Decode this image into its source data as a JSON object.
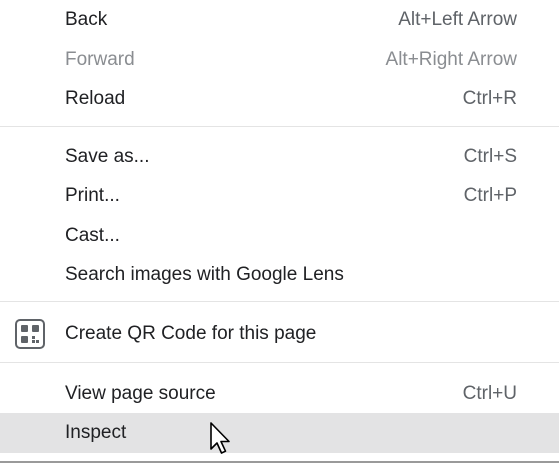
{
  "menu": {
    "items": [
      {
        "label": "Back",
        "shortcut": "Alt+Left Arrow",
        "enabled": true
      },
      {
        "label": "Forward",
        "shortcut": "Alt+Right Arrow",
        "enabled": false
      },
      {
        "label": "Reload",
        "shortcut": "Ctrl+R",
        "enabled": true
      },
      {
        "label": "Save as...",
        "shortcut": "Ctrl+S",
        "enabled": true
      },
      {
        "label": "Print...",
        "shortcut": "Ctrl+P",
        "enabled": true
      },
      {
        "label": "Cast...",
        "shortcut": "",
        "enabled": true
      },
      {
        "label": "Search images with Google Lens",
        "shortcut": "",
        "enabled": true
      },
      {
        "label": "Create QR Code for this page",
        "shortcut": "",
        "icon": "qr-code-icon",
        "enabled": true
      },
      {
        "label": "View page source",
        "shortcut": "Ctrl+U",
        "enabled": true
      },
      {
        "label": "Inspect",
        "shortcut": "",
        "enabled": true,
        "hovered": true
      }
    ]
  },
  "colors": {
    "text": "#202124",
    "shortcut": "#5f6368",
    "disabled": "#8a8d91",
    "hover": "#e3e3e4",
    "separator": "#e4e4e4"
  },
  "cursor_icon": "arrow-pointer-icon"
}
